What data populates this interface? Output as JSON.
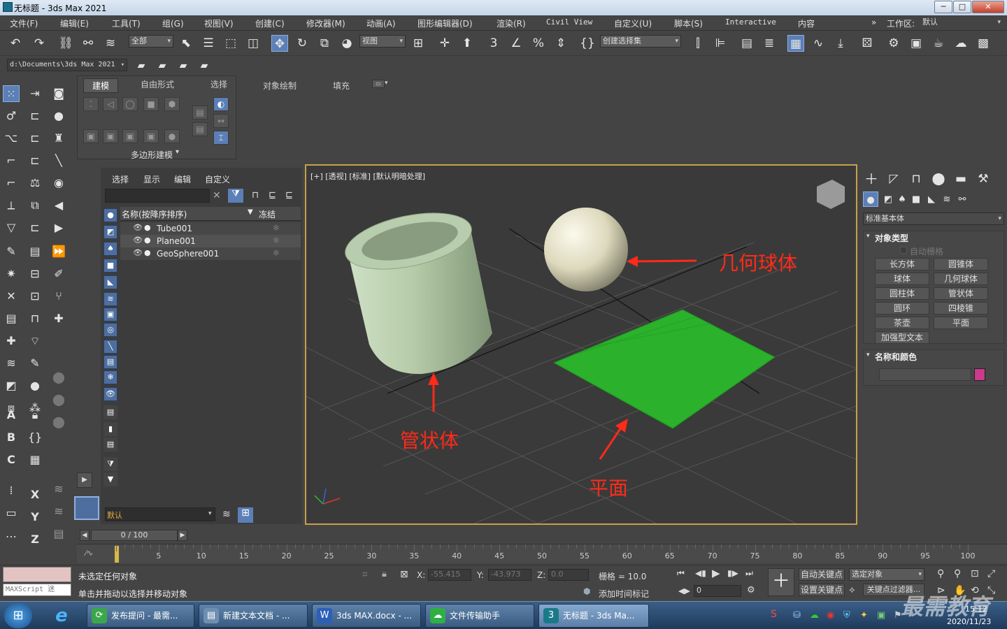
{
  "window": {
    "title": "无标题 - 3ds Max 2021",
    "minimize": "─",
    "maximize": "□",
    "close": "✕"
  },
  "menu": [
    "文件(F)",
    "编辑(E)",
    "工具(T)",
    "组(G)",
    "视图(V)",
    "创建(C)",
    "修改器(M)",
    "动画(A)",
    "图形编辑器(D)",
    "渲染(R)",
    "Civil View",
    "自定义(U)",
    "脚本(S)",
    "Interactive",
    "内容"
  ],
  "workspace": {
    "label": "工作区:",
    "value": "默认",
    "chevron": "»"
  },
  "toolbar": {
    "selection_filter": "全部",
    "ref_coord": "视图",
    "named_selection": "创建选择集"
  },
  "project_path": "d:\\Documents\\3ds Max 2021",
  "ribbon": {
    "tabs": [
      "建模",
      "自由形式",
      "选择",
      "对象绘制",
      "填充"
    ],
    "active_tab": "建模",
    "group_label": "多边形建模"
  },
  "scene_explorer": {
    "tabs": [
      "选择",
      "显示",
      "编辑",
      "自定义"
    ],
    "col_name": "名称(按降序排序)",
    "col_freeze": "冻结",
    "objects": [
      "Tube001",
      "Plane001",
      "GeoSphere001"
    ],
    "layer": "默认"
  },
  "viewport": {
    "label": "[+] [透视] [标准] [默认明暗处理]",
    "annotations": {
      "geosphere": "几何球体",
      "tube": "管状体",
      "plane": "平面"
    },
    "colors": {
      "tube": "#b9cfae",
      "sphere": "#e9e6cc",
      "plane": "#2bb12b",
      "annotation": "#ff2a1a",
      "border": "#c8a04b"
    }
  },
  "command_panel": {
    "category": "标准基本体",
    "rollout_object_type": "对象类型",
    "autogrid": "自动栅格",
    "buttons": [
      "长方体",
      "圆锥体",
      "球体",
      "几何球体",
      "圆柱体",
      "管状体",
      "圆环",
      "四棱锥",
      "茶壶",
      "平面",
      "加强型文本"
    ],
    "rollout_name_color": "名称和颜色",
    "object_color": "#cc3a8c"
  },
  "timeline": {
    "frame": "0 / 100",
    "ticks": [
      "5",
      "10",
      "15",
      "20",
      "25",
      "30",
      "35",
      "40",
      "45",
      "50",
      "55",
      "60",
      "65",
      "70",
      "75",
      "80",
      "85",
      "90",
      "95",
      "100"
    ]
  },
  "status": {
    "maxscript": "MAXScript 迷",
    "line1": "未选定任何对象",
    "line2": "单击并拖动以选择并移动对象",
    "x_label": "X:",
    "x": "-55.415",
    "y_label": "Y:",
    "y": "-43.973",
    "z_label": "Z:",
    "z": "0.0",
    "grid": "栅格 = 10.0",
    "add_time_tag": "添加时间标记",
    "auto_key": "自动关键点",
    "selected": "选定对象",
    "set_key": "设置关键点",
    "key_filter": "关键点过滤器...",
    "frame_field": "0"
  },
  "taskbar": {
    "items": [
      "发布提问 - 最需...",
      "新建文本文档 - ...",
      "3ds MAX.docx - ...",
      "文件传输助手",
      "无标题 - 3ds Ma..."
    ],
    "watermark": "最需教育",
    "time": "15:12",
    "date": "2020/11/23"
  }
}
